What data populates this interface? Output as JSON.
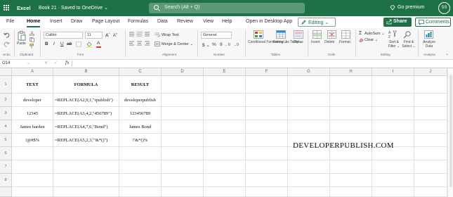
{
  "titlebar": {
    "app_name": "Excel",
    "document": "Book 21  ·  Saved to OneDrive ⌄",
    "search_placeholder": "Search (Alt + Q)",
    "premium": "Go premium",
    "avatar": "SS"
  },
  "menu": {
    "tabs": [
      "File",
      "Home",
      "Insert",
      "Draw",
      "Page Layout",
      "Formulas",
      "Data",
      "Review",
      "View",
      "Help",
      "Open in Desktop App"
    ],
    "active_tab": "Home",
    "editing": "Editing ⌄",
    "share": "Share",
    "comments": "Comments"
  },
  "ribbon": {
    "undo_group": "Undo",
    "clipboard_group": "Clipboard",
    "paste": "Paste",
    "font_name": "Calibri",
    "font_size": "11",
    "font_group": "Font",
    "wrap_text": "Wrap Text",
    "merge_center": "Merge & Center ⌄",
    "alignment_group": "Alignment",
    "number_format": "General",
    "number_group": "Number",
    "conditional_formatting": "Conditional Formatting ⌄",
    "format_as_table": "Format As Table ⌄",
    "styles": "Styles",
    "tables_group": "Tables",
    "insert": "Insert",
    "delete": "Delete",
    "format": "Format",
    "cells_group": "Cells",
    "autosum": "AutoSum ⌄",
    "clear": "Clear ⌄",
    "sort_filter": "Sort & Filter ⌄",
    "find_select": "Find & Select ⌄",
    "editing_group": "Editing",
    "analyze_data": "Analyze Data",
    "analysis_group": "Analysis"
  },
  "formula_bar": {
    "name_box": "O14",
    "fx": "fx",
    "formula": ""
  },
  "grid": {
    "columns": [
      "A",
      "B",
      "C",
      "D",
      "E",
      "F",
      "G",
      "H",
      "I",
      "J"
    ],
    "rows": [
      "1",
      "2",
      "3",
      "4",
      "5",
      "6",
      "7",
      "8"
    ],
    "cells": [
      [
        "TEXT",
        "FORMULA",
        "RESULT"
      ],
      [
        "developer",
        "=REPLACE(A2,9,1,\"rpublish\")",
        "developerpublish"
      ],
      [
        "12345",
        "=REPLACE(A3,4,2,\"456789\")",
        "123456789"
      ],
      [
        "James harden",
        "=REPLACE(A4,7,6,\"Bond\")",
        "James Bond"
      ],
      [
        "!@#$%",
        "=REPLACE(A5,2,3,\"'&*()\")",
        "!'&*()%"
      ]
    ]
  },
  "watermark": "DEVELOPERPUBLISH.COM",
  "colors": {
    "brand": "#1e7145"
  }
}
